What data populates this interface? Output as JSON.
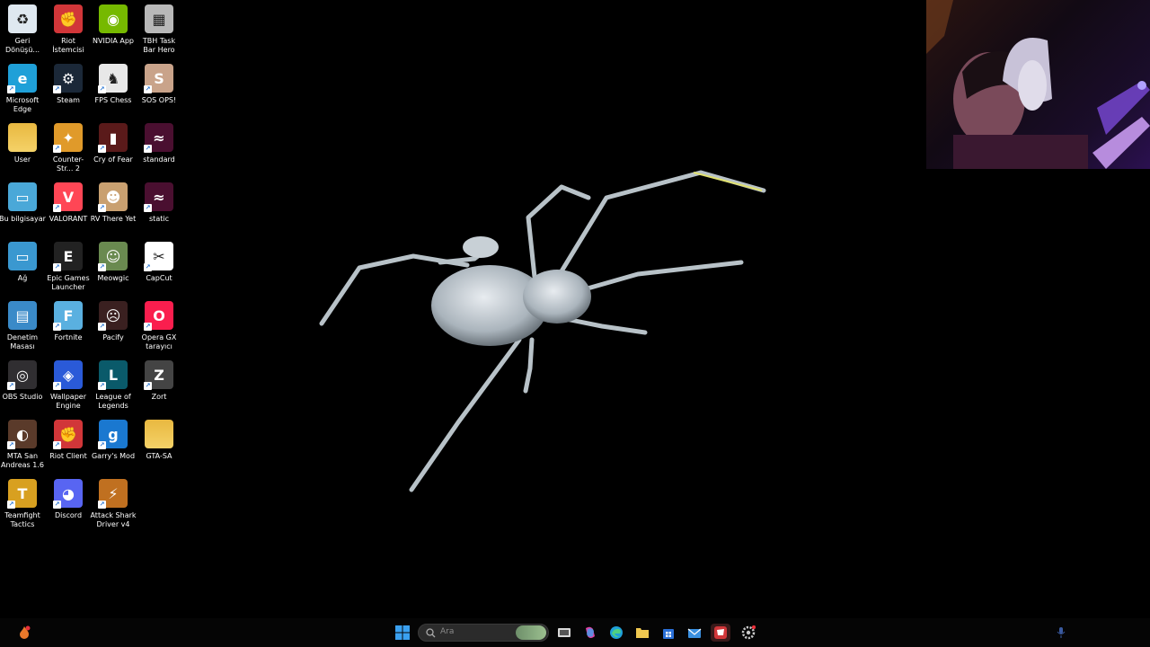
{
  "desktop_icons": [
    {
      "label": "Geri Dönüşü...",
      "icon": "recycle-bin-icon",
      "color": "#dfe8f0"
    },
    {
      "label": "Riot İstemcisi",
      "icon": "riot-client-icon",
      "color": "#d13639"
    },
    {
      "label": "NVIDIA App",
      "icon": "nvidia-icon",
      "color": "#76b900"
    },
    {
      "label": "TBH Task Bar Hero",
      "icon": "tbh-icon",
      "color": "#b8b8b8"
    },
    {
      "label": "Microsoft Edge",
      "icon": "edge-icon",
      "color": "#1fa0d8"
    },
    {
      "label": "Steam",
      "icon": "steam-icon",
      "color": "#1b2838"
    },
    {
      "label": "FPS Chess",
      "icon": "fps-chess-icon",
      "color": "#e8e8e8"
    },
    {
      "label": "SOS OPS!",
      "icon": "sos-ops-icon",
      "color": "#c9a38a"
    },
    {
      "label": "User",
      "icon": "folder-icon",
      "color": "#f0c850"
    },
    {
      "label": "Counter-Str... 2",
      "icon": "counter-strike-icon",
      "color": "#e09a2a"
    },
    {
      "label": "Cry of Fear",
      "icon": "cry-of-fear-icon",
      "color": "#5a1a1a"
    },
    {
      "label": "standard",
      "icon": "standard-icon",
      "color": "#4a0f30"
    },
    {
      "label": "Bu bilgisayar",
      "icon": "this-pc-icon",
      "color": "#4aa8d8"
    },
    {
      "label": "VALORANT",
      "icon": "valorant-icon",
      "color": "#ff4655"
    },
    {
      "label": "RV There Yet",
      "icon": "rv-there-yet-icon",
      "color": "#c9a070"
    },
    {
      "label": "static",
      "icon": "static-icon",
      "color": "#4a0f30"
    },
    {
      "label": "Ağ",
      "icon": "network-icon",
      "color": "#3a98d0"
    },
    {
      "label": "Epic Games Launcher",
      "icon": "epic-games-icon",
      "color": "#222222"
    },
    {
      "label": "Meowgic",
      "icon": "meowgic-icon",
      "color": "#6a8a50"
    },
    {
      "label": "CapCut",
      "icon": "capcut-icon",
      "color": "#ffffff"
    },
    {
      "label": "Denetim Masası",
      "icon": "control-panel-icon",
      "color": "#3a8ac8"
    },
    {
      "label": "Fortnite",
      "icon": "fortnite-icon",
      "color": "#5ab0e0"
    },
    {
      "label": "Pacify",
      "icon": "pacify-icon",
      "color": "#3a2020"
    },
    {
      "label": "Opera GX tarayıcı",
      "icon": "opera-gx-icon",
      "color": "#fa1e4e"
    },
    {
      "label": "OBS Studio",
      "icon": "obs-icon",
      "color": "#302e31"
    },
    {
      "label": "Wallpaper Engine",
      "icon": "wallpaper-engine-icon",
      "color": "#2a5ad8"
    },
    {
      "label": "League of Legends",
      "icon": "league-of-legends-icon",
      "color": "#0a5a6a"
    },
    {
      "label": "Zort",
      "icon": "zort-icon",
      "color": "#444444"
    },
    {
      "label": "MTA San Andreas 1.6",
      "icon": "mta-icon",
      "color": "#5a3a2a"
    },
    {
      "label": "Riot Client",
      "icon": "riot-client-icon",
      "color": "#d13639"
    },
    {
      "label": "Garry's Mod",
      "icon": "garrys-mod-icon",
      "color": "#1a78d0"
    },
    {
      "label": "GTA-SA",
      "icon": "folder-icon",
      "color": "#f0c850"
    },
    {
      "label": "Teamfight Tactics",
      "icon": "teamfight-tactics-icon",
      "color": "#d8a020"
    },
    {
      "label": "Discord",
      "icon": "discord-icon",
      "color": "#5865f2"
    },
    {
      "label": "Attack Shark Driver v4",
      "icon": "attack-shark-icon",
      "color": "#c07020"
    }
  ],
  "taskbar": {
    "search_placeholder": "Ara",
    "apps": [
      "start-icon",
      "task-view-icon",
      "copilot-icon",
      "edge-icon",
      "file-explorer-icon",
      "store-icon",
      "mail-icon",
      "riot-client-icon",
      "settings-icon"
    ]
  },
  "colors": {
    "taskbar": "#050505",
    "desktop": "#000000",
    "accent": "#1f8fff"
  }
}
